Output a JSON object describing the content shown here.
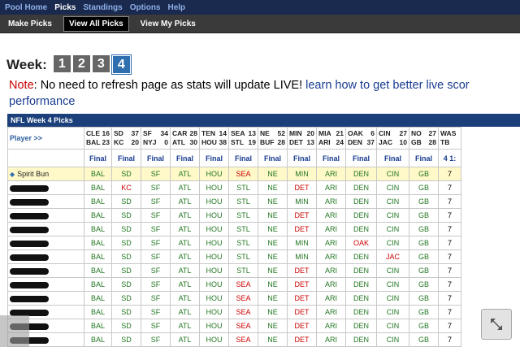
{
  "topnav": [
    "Pool Home",
    "Picks",
    "Standings",
    "Options",
    "Help"
  ],
  "topnav_active": 1,
  "subnav": [
    "Make Picks",
    "View All Picks",
    "View My Picks"
  ],
  "subnav_active": 1,
  "week_label": "Week:",
  "weeks": [
    "1",
    "2",
    "3",
    "4"
  ],
  "week_active": 3,
  "note": {
    "prefix": "Note",
    "text": ": No need to refresh page as stats will update LIVE! ",
    "link": "learn how to get better live scor",
    "link2": "performance"
  },
  "table": {
    "title": "NFL Week 4 Picks",
    "player_header": "Player  >>",
    "games": [
      {
        "t1": "CLE",
        "s1": "16",
        "t2": "BAL",
        "s2": "23"
      },
      {
        "t1": "SD",
        "s1": "37",
        "t2": "KC",
        "s2": "20"
      },
      {
        "t1": "SF",
        "s1": "34",
        "t2": "NYJ",
        "s2": "0"
      },
      {
        "t1": "CAR",
        "s1": "28",
        "t2": "ATL",
        "s2": "30"
      },
      {
        "t1": "TEN",
        "s1": "14",
        "t2": "HOU",
        "s2": "38"
      },
      {
        "t1": "SEA",
        "s1": "13",
        "t2": "STL",
        "s2": "19"
      },
      {
        "t1": "NE",
        "s1": "52",
        "t2": "BUF",
        "s2": "28"
      },
      {
        "t1": "MIN",
        "s1": "20",
        "t2": "DET",
        "s2": "13"
      },
      {
        "t1": "MIA",
        "s1": "21",
        "t2": "ARI",
        "s2": "24"
      },
      {
        "t1": "OAK",
        "s1": "6",
        "t2": "DEN",
        "s2": "37"
      },
      {
        "t1": "CIN",
        "s1": "27",
        "t2": "JAC",
        "s2": "10"
      },
      {
        "t1": "NO",
        "s1": "27",
        "t2": "GB",
        "s2": "28"
      },
      {
        "t1": "WAS",
        "s1": "",
        "t2": "TB",
        "s2": ""
      }
    ],
    "status": [
      "Final",
      "Final",
      "Final",
      "Final",
      "Final",
      "Final",
      "Final",
      "Final",
      "Final",
      "Final",
      "Final",
      "Final",
      "4 1:"
    ],
    "me_name": "Spirit Bun",
    "rows": [
      [
        "BAL",
        "SD",
        "SF",
        "ATL",
        "HOU",
        "SEA",
        "NE",
        "MIN",
        "ARI",
        "DEN",
        "CIN",
        "GB",
        "7"
      ],
      [
        "BAL",
        "KC",
        "SF",
        "ATL",
        "HOU",
        "STL",
        "NE",
        "DET",
        "ARI",
        "DEN",
        "CIN",
        "GB",
        "7"
      ],
      [
        "BAL",
        "SD",
        "SF",
        "ATL",
        "HOU",
        "STL",
        "NE",
        "MIN",
        "ARI",
        "DEN",
        "CIN",
        "GB",
        "7"
      ],
      [
        "BAL",
        "SD",
        "SF",
        "ATL",
        "HOU",
        "STL",
        "NE",
        "DET",
        "ARI",
        "DEN",
        "CIN",
        "GB",
        "7"
      ],
      [
        "BAL",
        "SD",
        "SF",
        "ATL",
        "HOU",
        "STL",
        "NE",
        "DET",
        "ARI",
        "DEN",
        "CIN",
        "GB",
        "7"
      ],
      [
        "BAL",
        "SD",
        "SF",
        "ATL",
        "HOU",
        "STL",
        "NE",
        "MIN",
        "ARI",
        "OAK",
        "CIN",
        "GB",
        "7"
      ],
      [
        "BAL",
        "SD",
        "SF",
        "ATL",
        "HOU",
        "STL",
        "NE",
        "MIN",
        "ARI",
        "DEN",
        "JAC",
        "GB",
        "7"
      ],
      [
        "BAL",
        "SD",
        "SF",
        "ATL",
        "HOU",
        "STL",
        "NE",
        "DET",
        "ARI",
        "DEN",
        "CIN",
        "GB",
        "7"
      ],
      [
        "BAL",
        "SD",
        "SF",
        "ATL",
        "HOU",
        "SEA",
        "NE",
        "DET",
        "ARI",
        "DEN",
        "CIN",
        "GB",
        "7"
      ],
      [
        "BAL",
        "SD",
        "SF",
        "ATL",
        "HOU",
        "SEA",
        "NE",
        "DET",
        "ARI",
        "DEN",
        "CIN",
        "GB",
        "7"
      ],
      [
        "BAL",
        "SD",
        "SF",
        "ATL",
        "HOU",
        "SEA",
        "NE",
        "DET",
        "ARI",
        "DEN",
        "CIN",
        "GB",
        "7"
      ],
      [
        "BAL",
        "SD",
        "SF",
        "ATL",
        "HOU",
        "SEA",
        "NE",
        "DET",
        "ARI",
        "DEN",
        "CIN",
        "GB",
        "7"
      ],
      [
        "BAL",
        "SD",
        "SF",
        "ATL",
        "HOU",
        "SEA",
        "NE",
        "DET",
        "ARI",
        "DEN",
        "CIN",
        "GB",
        "7"
      ]
    ],
    "winners": [
      "BAL",
      "SD",
      "SF",
      "ATL",
      "HOU",
      "STL",
      "NE",
      "MIN",
      "ARI",
      "DEN",
      "CIN",
      "GB",
      ""
    ]
  },
  "icons": {
    "expand": "expand-icon",
    "helmet": "helmet-icon"
  },
  "colors": {
    "nav_bg": "#1a2a4f",
    "win": "#227722",
    "loss": "#cc0000",
    "highlight": "#fff8c8"
  }
}
